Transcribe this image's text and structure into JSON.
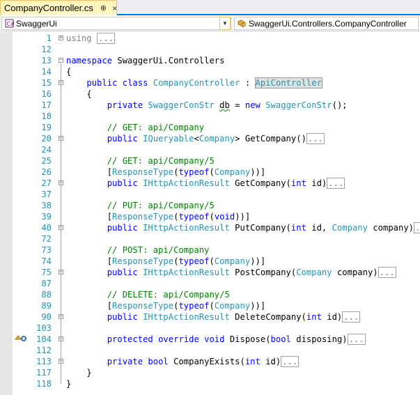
{
  "tab": {
    "title": "CompanyController.cs",
    "pin_glyph": "⊕",
    "close_glyph": "×"
  },
  "nav": {
    "project": "SwaggerUi",
    "type": "SwaggerUi.Controllers.CompanyController"
  },
  "icons": {
    "project": "csharp-project-icon",
    "type": "class-icon",
    "breakpoint": "code-lens-icon"
  },
  "colors": {
    "keyword": "#0000ff",
    "type": "#2b91af",
    "comment": "#008000",
    "linenum": "#2b91af",
    "accent": "#007acc"
  },
  "lines": [
    {
      "n": "1"
    },
    {
      "n": "12"
    },
    {
      "n": "13"
    },
    {
      "n": "14"
    },
    {
      "n": "15"
    },
    {
      "n": "16"
    },
    {
      "n": "17"
    },
    {
      "n": "18"
    },
    {
      "n": "19"
    },
    {
      "n": "20"
    },
    {
      "n": "24"
    },
    {
      "n": "25"
    },
    {
      "n": "26"
    },
    {
      "n": "27"
    },
    {
      "n": "37"
    },
    {
      "n": "38"
    },
    {
      "n": "39"
    },
    {
      "n": "40"
    },
    {
      "n": "72"
    },
    {
      "n": "73"
    },
    {
      "n": "74"
    },
    {
      "n": "75"
    },
    {
      "n": "87"
    },
    {
      "n": "88"
    },
    {
      "n": "89"
    },
    {
      "n": "90"
    },
    {
      "n": "103"
    },
    {
      "n": "104"
    },
    {
      "n": "112"
    },
    {
      "n": "113"
    },
    {
      "n": "117"
    },
    {
      "n": "118"
    }
  ],
  "code": {
    "using": "using",
    "ellipsis": "...",
    "namespace": "namespace",
    "ns_name": " SwaggerUi.Controllers",
    "brace_open": "{",
    "brace_close": "}",
    "public": "public",
    "class": "class",
    "class_name": "CompanyController",
    "colon": " : ",
    "base": "ApiController",
    "private": "private",
    "db_type": "SwaggerConStr",
    "db": "db",
    "new": "new",
    "db_init_end": "();",
    "c_get_all": "// GET: api/Company",
    "iqueryable": "IQueryable",
    "company": "Company",
    "get_company_all": " GetCompany()",
    "c_get_one": "// GET: api/Company/5",
    "response_type": "ResponseType",
    "typeof": "typeof",
    "ihttp": "IHttpActionResult",
    "get_company": " GetCompany(",
    "int": "int",
    "id_close": " id)",
    "c_put": "// PUT: api/Company/5",
    "void": "void",
    "put_company": " PutCompany(",
    "id_comma": " id, ",
    "company_param": " company)",
    "c_post": "// POST: api/Company",
    "post_company": " PostCompany(",
    "c_delete": "// DELETE: api/Company/5",
    "delete_company": " DeleteCompany(",
    "protected": "protected",
    "override": "override",
    "dispose": " Dispose(",
    "bool": "bool",
    "disposing": " disposing)",
    "company_exists": " CompanyExists("
  }
}
